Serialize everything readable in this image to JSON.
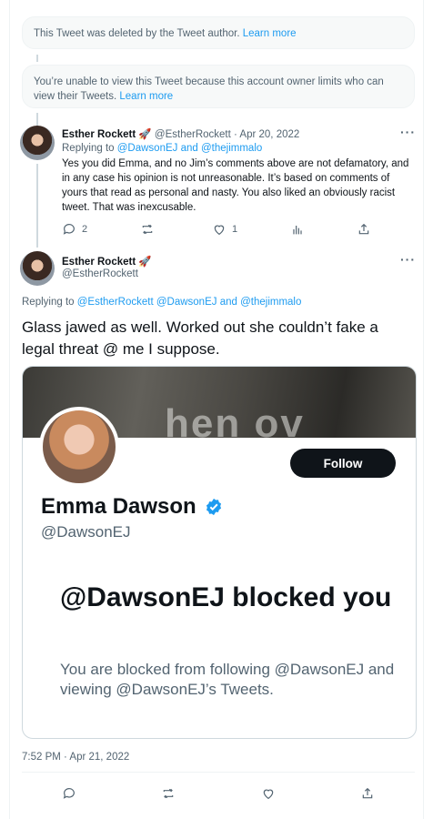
{
  "deleted_notice": {
    "text": "This Tweet was deleted by the Tweet author.",
    "link": "Learn more"
  },
  "limited_notice": {
    "text": "You’re unable to view this Tweet because this account owner limits who can view their Tweets.",
    "link": "Learn more"
  },
  "reply_tweet": {
    "name": "Esther Rockett",
    "emoji": "🚀",
    "handle": "@EstherRockett",
    "separator": "·",
    "date": "Apr 20, 2022",
    "replying_prefix": "Replying to",
    "replying_to_1": "@DawsonEJ",
    "replying_and": "and",
    "replying_to_2": "@thejimmalo",
    "text": "Yes you did Emma, and no Jim’s comments above are not defamatory, and in any case his opinion is not unreasonable. It’s based on comments of yours that read as personal and nasty. You also liked an obviously racist tweet. That was inexcusable.",
    "reply_count": "2",
    "retweet_count": "",
    "like_count": "1"
  },
  "main_tweet": {
    "name": "Esther Rockett",
    "emoji": "🚀",
    "handle": "@EstherRockett",
    "replying_prefix": "Replying to",
    "replying_to_1": "@EstherRockett",
    "replying_to_2": "@DawsonEJ",
    "replying_and": "and",
    "replying_to_3": "@thejimmalo",
    "text": "Glass jawed as well. Worked out she couldn’t fake a legal threat @ me I suppose.",
    "timestamp": "7:52 PM · Apr 21, 2022"
  },
  "embedded_screenshot": {
    "banner_text": "hen     ov",
    "follow_label": "Follow",
    "profile_name": "Emma Dawson",
    "profile_handle": "@DawsonEJ",
    "blocked_title": "@DawsonEJ blocked you",
    "blocked_subtitle": "You are blocked from following @DawsonEJ and viewing @DawsonEJ’s Tweets."
  },
  "more_label": "···",
  "colors": {
    "link": "#1d9bf0",
    "muted": "#536471",
    "text": "#0f1419",
    "verified": "#1d9bf0"
  }
}
